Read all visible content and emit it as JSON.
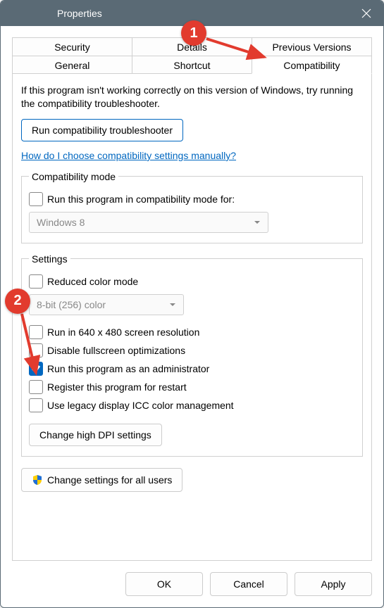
{
  "window": {
    "title": "Properties"
  },
  "tabs": {
    "security": "Security",
    "details": "Details",
    "previous_versions": "Previous Versions",
    "general": "General",
    "shortcut": "Shortcut",
    "compatibility": "Compatibility"
  },
  "intro": "If this program isn't working correctly on this version of Windows, try running the compatibility troubleshooter.",
  "troubleshooter_btn": "Run compatibility troubleshooter",
  "help_link": "How do I choose compatibility settings manually?",
  "compat_mode": {
    "legend": "Compatibility mode",
    "run_label": "Run this program in compatibility mode for:",
    "run_checked": false,
    "os_selected": "Windows 8"
  },
  "settings": {
    "legend": "Settings",
    "reduced_color_label": "Reduced color mode",
    "reduced_color_checked": false,
    "color_selected": "8-bit (256) color",
    "run_640_label": "Run in 640 x 480 screen resolution",
    "run_640_checked": false,
    "disable_fullscreen_label": "Disable fullscreen optimizations",
    "disable_fullscreen_checked": false,
    "run_admin_label": "Run this program as an administrator",
    "run_admin_checked": true,
    "register_restart_label": "Register this program for restart",
    "register_restart_checked": false,
    "legacy_icc_label": "Use legacy display ICC color management",
    "legacy_icc_checked": false,
    "dpi_btn": "Change high DPI settings"
  },
  "all_users_btn": "Change settings for all users",
  "footer": {
    "ok": "OK",
    "cancel": "Cancel",
    "apply": "Apply"
  },
  "annotations": {
    "step1": "1",
    "step2": "2"
  }
}
